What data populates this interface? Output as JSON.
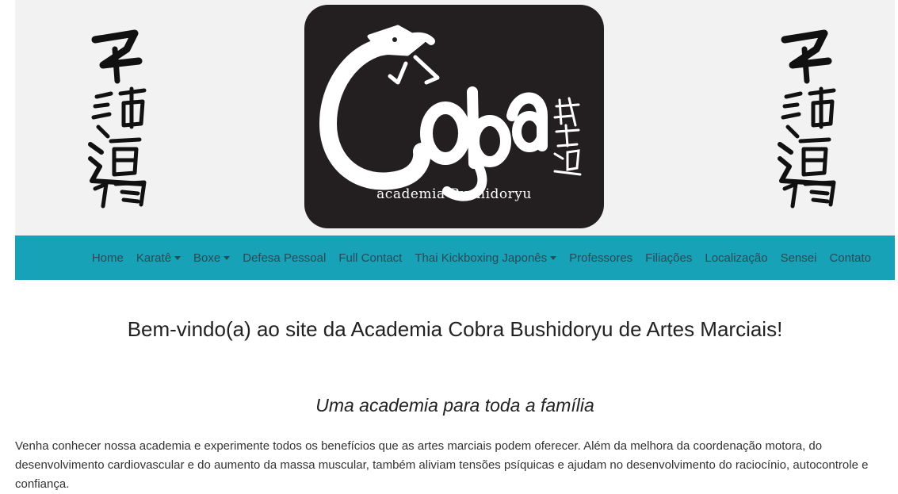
{
  "banner": {
    "calligraphy_left_icon": "kanji-calligraphy-icon",
    "calligraphy_right_icon": "kanji-calligraphy-icon",
    "logo": {
      "wordmark": "Cobra",
      "kanji": "武士道流",
      "tagline": "academia  Bushidoryu"
    }
  },
  "nav": {
    "items": [
      {
        "label": "Home",
        "dropdown": false
      },
      {
        "label": "Karatê",
        "dropdown": true
      },
      {
        "label": "Boxe",
        "dropdown": true
      },
      {
        "label": "Defesa Pessoal",
        "dropdown": false
      },
      {
        "label": "Full Contact",
        "dropdown": false
      },
      {
        "label": "Thai Kickboxing Japonês",
        "dropdown": true
      },
      {
        "label": "Professores",
        "dropdown": false
      },
      {
        "label": "Filiações",
        "dropdown": false
      },
      {
        "label": "Localização",
        "dropdown": false
      },
      {
        "label": "Sensei",
        "dropdown": false
      },
      {
        "label": "Contato",
        "dropdown": false
      }
    ]
  },
  "main": {
    "welcome": "Bem-vindo(a) ao site da Academia Cobra Bushidoryu de Artes Marciais!",
    "subtitle": "Uma academia para toda a família",
    "intro": "Venha conhecer nossa academia e experimente todos os benefícios que as artes marciais podem oferecer. Além da melhora da coordenação motora, do desenvolvimento cardiovascular e do aumento da massa muscular, também aliviam tensões psíquicas e ajudam no desenvolvimento do raciocínio, autocontrole e confiança."
  },
  "colors": {
    "navbar": "#17a2b8",
    "nav_text": "#2c4a55",
    "logo_bg": "#231f20",
    "banner_bg": "#f2f2f2"
  }
}
